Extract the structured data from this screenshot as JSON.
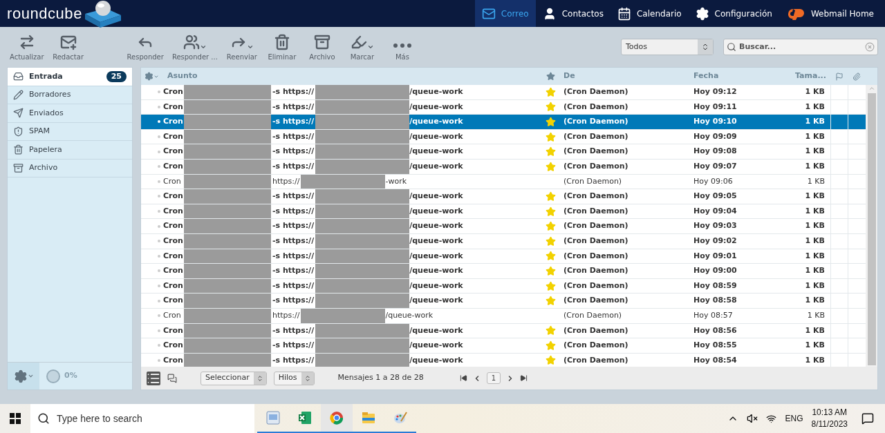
{
  "header": {
    "logo": "roundcube",
    "nav": [
      {
        "label": "Correo",
        "kind": "mail",
        "selected": true
      },
      {
        "label": "Contactos",
        "kind": "contacts",
        "selected": false
      },
      {
        "label": "Calendario",
        "kind": "calendar",
        "selected": false
      },
      {
        "label": "Configuración",
        "kind": "settings",
        "selected": false
      },
      {
        "label": "Webmail Home",
        "kind": "cpanel",
        "selected": false
      }
    ]
  },
  "toolbar": {
    "buttons": [
      {
        "label": "Actualizar",
        "kind": "refresh",
        "menu": false
      },
      {
        "label": "Redactar",
        "kind": "compose",
        "menu": false
      },
      {
        "label": "Responder",
        "kind": "reply",
        "menu": false
      },
      {
        "label": "Responder ...",
        "kind": "reply-all",
        "menu": true
      },
      {
        "label": "Reenviar",
        "kind": "forward",
        "menu": true
      },
      {
        "label": "Eliminar",
        "kind": "delete",
        "menu": false
      },
      {
        "label": "Archivo",
        "kind": "archive",
        "menu": false
      },
      {
        "label": "Marcar",
        "kind": "mark",
        "menu": true
      },
      {
        "label": "Más",
        "kind": "more",
        "menu": false
      }
    ],
    "filter": {
      "value": "Todos"
    },
    "search": {
      "placeholder": "Buscar..."
    }
  },
  "folders": [
    {
      "label": "Entrada",
      "kind": "inbox",
      "selected": true,
      "count": "25"
    },
    {
      "label": "Borradores",
      "kind": "drafts",
      "selected": false
    },
    {
      "label": "Enviados",
      "kind": "sent",
      "selected": false
    },
    {
      "label": "SPAM",
      "kind": "spam",
      "selected": false
    },
    {
      "label": "Papelera",
      "kind": "trash",
      "selected": false
    },
    {
      "label": "Archivo",
      "kind": "archive",
      "selected": false
    }
  ],
  "quota": {
    "text": "0%"
  },
  "list": {
    "columns": {
      "subject": "Asunto",
      "from": "De",
      "date": "Fecha",
      "size": "Tama..."
    },
    "rows": [
      {
        "parts": [
          "Cron",
          "-s https://",
          "/queue-work"
        ],
        "from": "(Cron Daemon)",
        "date": "Hoy 09:12",
        "size": "1 KB",
        "unread": true,
        "flagged": true,
        "selected": false
      },
      {
        "parts": [
          "Cron",
          "-s https://",
          "/queue-work"
        ],
        "from": "(Cron Daemon)",
        "date": "Hoy 09:11",
        "size": "1 KB",
        "unread": true,
        "flagged": true,
        "selected": false
      },
      {
        "parts": [
          "Cron",
          "-s https://",
          "/queue-work"
        ],
        "from": "(Cron Daemon)",
        "date": "Hoy 09:10",
        "size": "1 KB",
        "unread": true,
        "flagged": true,
        "selected": true
      },
      {
        "parts": [
          "Cron",
          "-s https://",
          "/queue-work"
        ],
        "from": "(Cron Daemon)",
        "date": "Hoy 09:09",
        "size": "1 KB",
        "unread": true,
        "flagged": true,
        "selected": false
      },
      {
        "parts": [
          "Cron",
          "-s https://",
          "/queue-work"
        ],
        "from": "(Cron Daemon)",
        "date": "Hoy 09:08",
        "size": "1 KB",
        "unread": true,
        "flagged": true,
        "selected": false
      },
      {
        "parts": [
          "Cron",
          "-s https://",
          "/queue-work"
        ],
        "from": "(Cron Daemon)",
        "date": "Hoy 09:07",
        "size": "1 KB",
        "unread": true,
        "flagged": true,
        "selected": false
      },
      {
        "parts": [
          "Cron",
          "https://",
          "-work"
        ],
        "from": "(Cron Daemon)",
        "date": "Hoy 09:06",
        "size": "1 KB",
        "unread": false,
        "flagged": false,
        "selected": false
      },
      {
        "parts": [
          "Cron",
          "-s https://",
          "/queue-work"
        ],
        "from": "(Cron Daemon)",
        "date": "Hoy 09:05",
        "size": "1 KB",
        "unread": true,
        "flagged": true,
        "selected": false
      },
      {
        "parts": [
          "Cron",
          "-s https://",
          "/queue-work"
        ],
        "from": "(Cron Daemon)",
        "date": "Hoy 09:04",
        "size": "1 KB",
        "unread": true,
        "flagged": true,
        "selected": false
      },
      {
        "parts": [
          "Cron",
          "-s https://",
          "/queue-work"
        ],
        "from": "(Cron Daemon)",
        "date": "Hoy 09:03",
        "size": "1 KB",
        "unread": true,
        "flagged": true,
        "selected": false
      },
      {
        "parts": [
          "Cron",
          "-s https://",
          "/queue-work"
        ],
        "from": "(Cron Daemon)",
        "date": "Hoy 09:02",
        "size": "1 KB",
        "unread": true,
        "flagged": true,
        "selected": false
      },
      {
        "parts": [
          "Cron",
          "-s https://",
          "/queue-work"
        ],
        "from": "(Cron Daemon)",
        "date": "Hoy 09:01",
        "size": "1 KB",
        "unread": true,
        "flagged": true,
        "selected": false
      },
      {
        "parts": [
          "Cron",
          "-s https://",
          "/queue-work"
        ],
        "from": "(Cron Daemon)",
        "date": "Hoy 09:00",
        "size": "1 KB",
        "unread": true,
        "flagged": true,
        "selected": false
      },
      {
        "parts": [
          "Cron",
          "-s https://",
          "/queue-work"
        ],
        "from": "(Cron Daemon)",
        "date": "Hoy 08:59",
        "size": "1 KB",
        "unread": true,
        "flagged": true,
        "selected": false
      },
      {
        "parts": [
          "Cron",
          "-s https://",
          "/queue-work"
        ],
        "from": "(Cron Daemon)",
        "date": "Hoy 08:58",
        "size": "1 KB",
        "unread": true,
        "flagged": true,
        "selected": false
      },
      {
        "parts": [
          "Cron",
          "https://",
          "/queue-work"
        ],
        "from": "(Cron Daemon)",
        "date": "Hoy 08:57",
        "size": "1 KB",
        "unread": false,
        "flagged": false,
        "selected": false
      },
      {
        "parts": [
          "Cron",
          "-s https://",
          "/queue-work"
        ],
        "from": "(Cron Daemon)",
        "date": "Hoy 08:56",
        "size": "1 KB",
        "unread": true,
        "flagged": true,
        "selected": false
      },
      {
        "parts": [
          "Cron",
          "-s https://",
          "/queue-work"
        ],
        "from": "(Cron Daemon)",
        "date": "Hoy 08:55",
        "size": "1 KB",
        "unread": true,
        "flagged": true,
        "selected": false
      },
      {
        "parts": [
          "Cron",
          "-s https://",
          "/queue-work"
        ],
        "from": "(Cron Daemon)",
        "date": "Hoy 08:54",
        "size": "1 KB",
        "unread": true,
        "flagged": true,
        "selected": false
      }
    ]
  },
  "footer": {
    "select": "Seleccionar",
    "threads": "Hilos",
    "count": "Mensajes 1 a 28 de 28",
    "page": "1"
  },
  "taskbar": {
    "search_placeholder": "Type here to search",
    "language": "ENG",
    "time": "10:13 AM",
    "date": "8/11/2023"
  }
}
